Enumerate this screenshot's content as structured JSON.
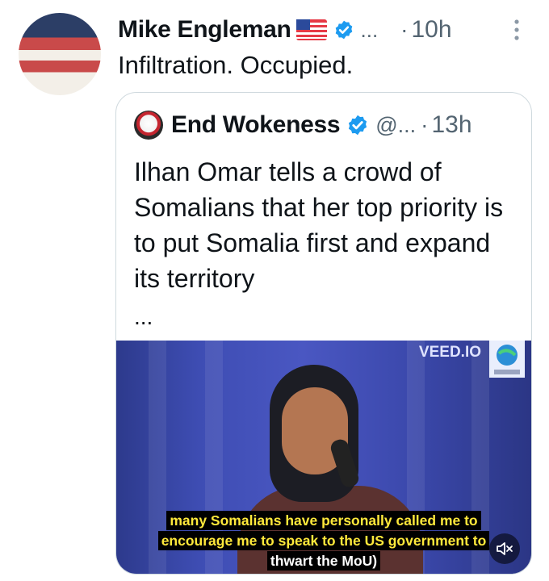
{
  "post": {
    "author": "Mike Engleman",
    "handle": "...",
    "dot": "·",
    "time": "10h",
    "text": "Infiltration. Occupied."
  },
  "quote": {
    "author": "End Wokeness",
    "handle": "@...",
    "dot": "·",
    "time": "13h",
    "text": "Ilhan Omar tells a crowd of Somalians that her top priority is to put Somalia first and expand its territory",
    "ellipsis": "...",
    "video": {
      "watermark": "VEED.IO",
      "caption_lines": [
        "many Somalians have personally called me to",
        "encourage me to speak to the US government to",
        "thwart the MoU)"
      ]
    }
  },
  "icons": {
    "verified": "verified-badge-icon",
    "flag": "us-flag-emoji",
    "more": "more-vertical-icon",
    "mute": "speaker-muted-icon"
  },
  "colors": {
    "verified": "#1d9bf0",
    "muted_text": "#536471",
    "caption": "#ffe93b"
  }
}
